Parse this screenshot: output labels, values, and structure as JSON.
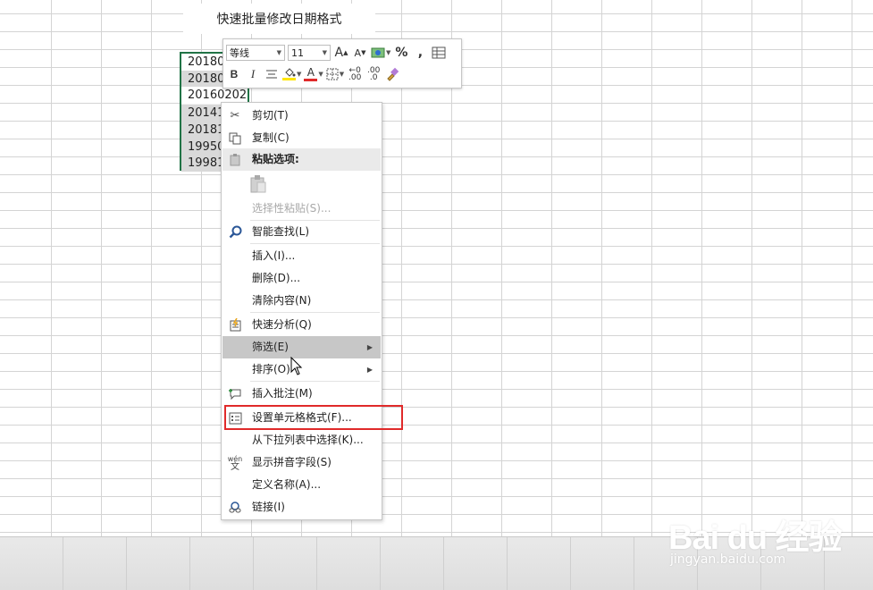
{
  "sheet": {
    "title": "快速批量修改日期格式",
    "cells": [
      "20180",
      "20180",
      "20160202",
      "20141",
      "20181",
      "19950",
      "19981"
    ]
  },
  "mini_toolbar": {
    "font_name": "等线",
    "font_size": "11",
    "grow_font": "A",
    "shrink_font": "A",
    "percent": "%",
    "comma": ",",
    "bold": "B",
    "italic": "I",
    "font_color_letter": "A",
    "inc_decimal": ".00",
    "dec_decimal": ".0",
    "accent_red": "#e02a2a",
    "highlight_yellow": "#ffe600"
  },
  "context_menu": {
    "items": [
      {
        "label": "剪切(T)",
        "icon": "scissors-icon"
      },
      {
        "label": "复制(C)",
        "icon": "copy-icon"
      },
      {
        "label": "粘贴选项:",
        "icon": "paste-icon"
      },
      {
        "label": "选择性粘贴(S)...",
        "icon": ""
      },
      {
        "label": "智能查找(L)",
        "icon": "search-icon"
      },
      {
        "label": "插入(I)...",
        "icon": ""
      },
      {
        "label": "删除(D)...",
        "icon": ""
      },
      {
        "label": "清除内容(N)",
        "icon": ""
      },
      {
        "label": "快速分析(Q)",
        "icon": "quick-analysis-icon"
      },
      {
        "label": "筛选(E)",
        "icon": ""
      },
      {
        "label": "排序(O)",
        "icon": ""
      },
      {
        "label": "插入批注(M)",
        "icon": "comment-icon"
      },
      {
        "label": "设置单元格格式(F)...",
        "icon": "format-cells-icon"
      },
      {
        "label": "从下拉列表中选择(K)...",
        "icon": ""
      },
      {
        "label": "显示拼音字段(S)",
        "icon": "phonetic-icon"
      },
      {
        "label": "定义名称(A)...",
        "icon": ""
      },
      {
        "label": "链接(I)",
        "icon": "link-icon"
      }
    ],
    "phonetic_glyph_top": "wén",
    "phonetic_glyph_bottom": "文"
  },
  "watermark": {
    "logo": "Bai du 经验",
    "url": "jingyan.baidu.com"
  }
}
